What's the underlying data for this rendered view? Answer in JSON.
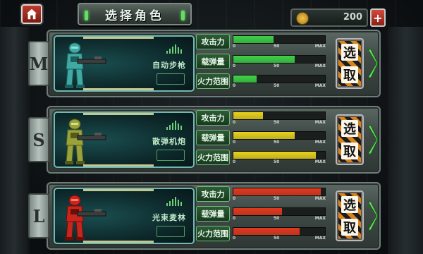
{
  "header": {
    "title": "选择角色",
    "coins": "200",
    "add_label": "+"
  },
  "ticks": {
    "zero": "0",
    "mid": "50",
    "max": "MAX"
  },
  "colors": {
    "green": "#3ed147",
    "yellow": "#e8d21e",
    "red": "#e23a1e"
  },
  "rows": [
    {
      "class_letter": "M",
      "weapon": "自动步枪",
      "soldier_color": "teal",
      "select_chars": [
        "选",
        "取"
      ],
      "stats": [
        {
          "label": "攻击力",
          "value": 0.44
        },
        {
          "label": "载弹量",
          "value": 0.67
        },
        {
          "label": "火力范围",
          "value": 0.25
        }
      ]
    },
    {
      "class_letter": "S",
      "weapon": "散弹机炮",
      "soldier_color": "olive",
      "select_chars": [
        "选",
        "取"
      ],
      "stats": [
        {
          "label": "攻击力",
          "value": 0.32
        },
        {
          "label": "载弹量",
          "value": 0.67
        },
        {
          "label": "火力范围",
          "value": 0.9
        }
      ]
    },
    {
      "class_letter": "L",
      "weapon": "光束麦林",
      "soldier_color": "red",
      "select_chars": [
        "选",
        "取"
      ],
      "stats": [
        {
          "label": "攻击力",
          "value": 0.95
        },
        {
          "label": "载弹量",
          "value": 0.53
        },
        {
          "label": "火力范围",
          "value": 0.72
        }
      ]
    }
  ]
}
